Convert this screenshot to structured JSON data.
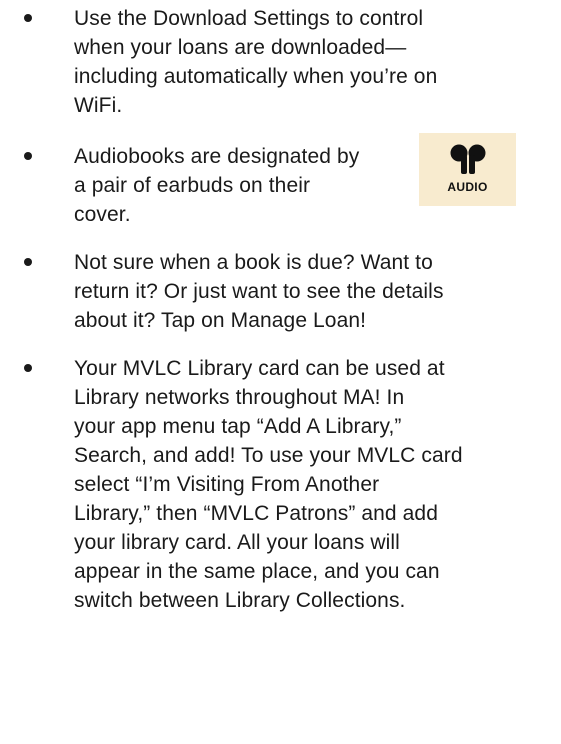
{
  "tips": [
    {
      "lines": [
        "Use the Download Settings to control",
        "when your loans are downloaded—",
        "including automatically when you’re on",
        "WiFi."
      ]
    },
    {
      "lines": [
        "Audiobooks are designated by",
        "a pair of earbuds on their",
        "cover."
      ]
    },
    {
      "lines": [
        "Not sure when a book is due?  Want to",
        "return it?  Or just want to see the details",
        "about it?  Tap on Manage Loan!"
      ]
    },
    {
      "lines": [
        "Your MVLC Library card can be used at",
        "Library networks throughout MA!  In",
        "your app menu tap “Add A Library,”",
        "Search, and add!  To use your MVLC card",
        "select “I’m Visiting From Another",
        "Library,” then “MVLC Patrons” and add",
        "your library card.  All your loans will",
        "appear in the same place, and you can",
        "switch between Library Collections."
      ]
    }
  ],
  "audio_badge": {
    "label": "AUDIO",
    "icon": "earbuds-icon",
    "background": "#f8ebcf"
  }
}
